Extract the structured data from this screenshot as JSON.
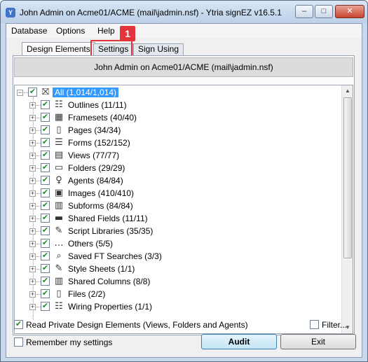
{
  "window": {
    "title": "John Admin on Acme01/ACME (mail\\jadmin.nsf) - Ytria signEZ v16.5.1",
    "app_icon": "signEZ-app-icon",
    "controls": {
      "minimize": "–",
      "maximize": "□",
      "close": "✕"
    }
  },
  "menu": {
    "items": [
      {
        "label": "Database"
      },
      {
        "label": "Options"
      },
      {
        "label": "Help"
      }
    ]
  },
  "tabs": [
    {
      "label": "Design Elements",
      "active": true
    },
    {
      "label": "Settings",
      "active": false,
      "highlighted": true
    },
    {
      "label": "Sign Using",
      "active": false
    }
  ],
  "annotation": {
    "step": "1",
    "color": "#e2343a"
  },
  "info_bar": {
    "text": "John Admin on Acme01/ACME (mail\\jadmin.nsf)"
  },
  "tree": {
    "root": {
      "label": "All  (1,014/1,014)",
      "checked": true,
      "icon": "database-icon"
    },
    "items": [
      {
        "label": "Outlines  (11/11)",
        "icon": "outline-icon",
        "glyph": "☷",
        "checked": true
      },
      {
        "label": "Framesets  (40/40)",
        "icon": "frameset-icon",
        "glyph": "▦",
        "checked": true
      },
      {
        "label": "Pages  (34/34)",
        "icon": "page-icon",
        "glyph": "▯",
        "checked": true
      },
      {
        "label": "Forms  (152/152)",
        "icon": "form-icon",
        "glyph": "☰",
        "checked": true
      },
      {
        "label": "Views  (77/77)",
        "icon": "view-icon",
        "glyph": "▤",
        "checked": true
      },
      {
        "label": "Folders  (29/29)",
        "icon": "folder-icon",
        "glyph": "▭",
        "checked": true
      },
      {
        "label": "Agents  (84/84)",
        "icon": "agent-icon",
        "glyph": "♀",
        "checked": true
      },
      {
        "label": "Images  (410/410)",
        "icon": "image-icon",
        "glyph": "▣",
        "checked": true
      },
      {
        "label": "Subforms  (84/84)",
        "icon": "subform-icon",
        "glyph": "▥",
        "checked": true
      },
      {
        "label": "Shared Fields  (11/11)",
        "icon": "shared-field-icon",
        "glyph": "▬",
        "checked": true
      },
      {
        "label": "Script Libraries  (35/35)",
        "icon": "script-library-icon",
        "glyph": "✎",
        "checked": true
      },
      {
        "label": "Others  (5/5)",
        "icon": "others-icon",
        "glyph": "…",
        "checked": true
      },
      {
        "label": "Saved FT Searches  (3/3)",
        "icon": "search-icon",
        "glyph": "⌕",
        "checked": true
      },
      {
        "label": "Style Sheets  (1/1)",
        "icon": "style-sheet-icon",
        "glyph": "✎",
        "checked": true
      },
      {
        "label": "Shared Columns  (8/8)",
        "icon": "shared-column-icon",
        "glyph": "▥",
        "checked": true
      },
      {
        "label": "Files  (2/2)",
        "icon": "file-icon",
        "glyph": "▯",
        "checked": true
      },
      {
        "label": "Wiring Properties  (1/1)",
        "icon": "wiring-icon",
        "glyph": "☷",
        "checked": true
      }
    ]
  },
  "bottom": {
    "read_private_label": "Read Private Design Elements (Views, Folders and Agents)",
    "read_private_checked": true,
    "filter_label": "Filter...",
    "filter_checked": false,
    "remember_label": "Remember my settings",
    "remember_checked": false,
    "audit_label": "Audit",
    "exit_label": "Exit"
  },
  "colors": {
    "selection": "#3399ff",
    "check": "#1d8a2b",
    "highlight_outline": "#e2343a"
  }
}
